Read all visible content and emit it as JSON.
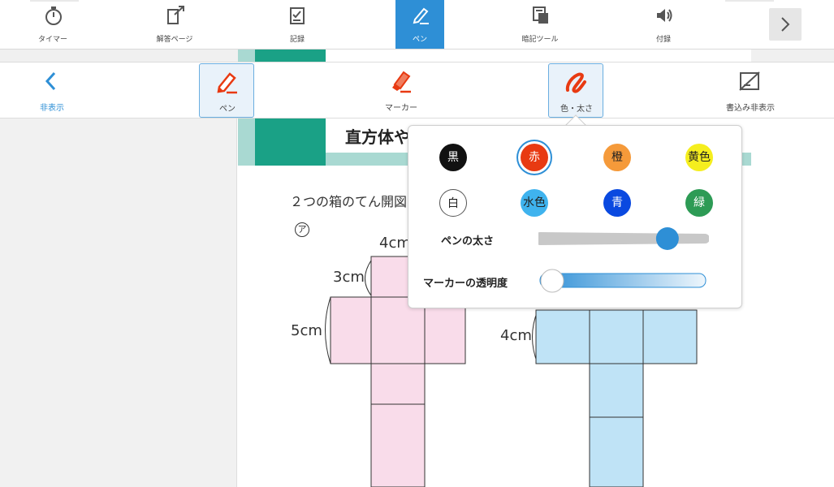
{
  "top_toolbar": {
    "items": [
      {
        "label": "タイマー",
        "icon": "stopwatch-icon"
      },
      {
        "label": "解答ページ",
        "icon": "answer-page-icon"
      },
      {
        "label": "記録",
        "icon": "record-icon"
      },
      {
        "label": "ペン",
        "icon": "pen-icon",
        "active": true
      },
      {
        "label": "暗記ツール",
        "icon": "memorize-tool-icon"
      },
      {
        "label": "付録",
        "icon": "appendix-icon"
      }
    ],
    "next_icon": "chevron-right-icon"
  },
  "pen_toolbar": {
    "hide_label": "非表示",
    "pen_label": "ペン",
    "marker_label": "マーカー",
    "color_width_label": "色・太さ",
    "hide_writing_label": "書込み非表示"
  },
  "document": {
    "subtitle": "直方体や",
    "question": "２つの箱のてん開図",
    "mark": "ア",
    "dims": {
      "a_top": "4cm",
      "a_side": "3cm",
      "a_height": "5cm",
      "b_side": "4cm"
    }
  },
  "color_popup": {
    "colors": [
      {
        "label": "黒",
        "hex": "#111111",
        "text": "#ffffff"
      },
      {
        "label": "赤",
        "hex": "#e83a12",
        "text": "#ffffff",
        "selected": true
      },
      {
        "label": "橙",
        "hex": "#f59a3a",
        "text": "#222222"
      },
      {
        "label": "黄色",
        "hex": "#f5ee1e",
        "text": "#222222"
      },
      {
        "label": "白",
        "hex": "#ffffff",
        "text": "#222222"
      },
      {
        "label": "水色",
        "hex": "#3fb3ee",
        "text": "#222222"
      },
      {
        "label": "青",
        "hex": "#0a49e0",
        "text": "#ffffff"
      },
      {
        "label": "緑",
        "hex": "#2d9b55",
        "text": "#ffffff"
      }
    ],
    "pen_width_label": "ペンの太さ",
    "pen_width_level": 0.82,
    "marker_opacity_label": "マーカーの透明度",
    "marker_opacity_level": 0.0
  },
  "colors": {
    "accent": "#2e8fd6",
    "teal": "#1aa186",
    "pink_net": "#f9dcea",
    "blue_net": "#bfe3f6"
  }
}
